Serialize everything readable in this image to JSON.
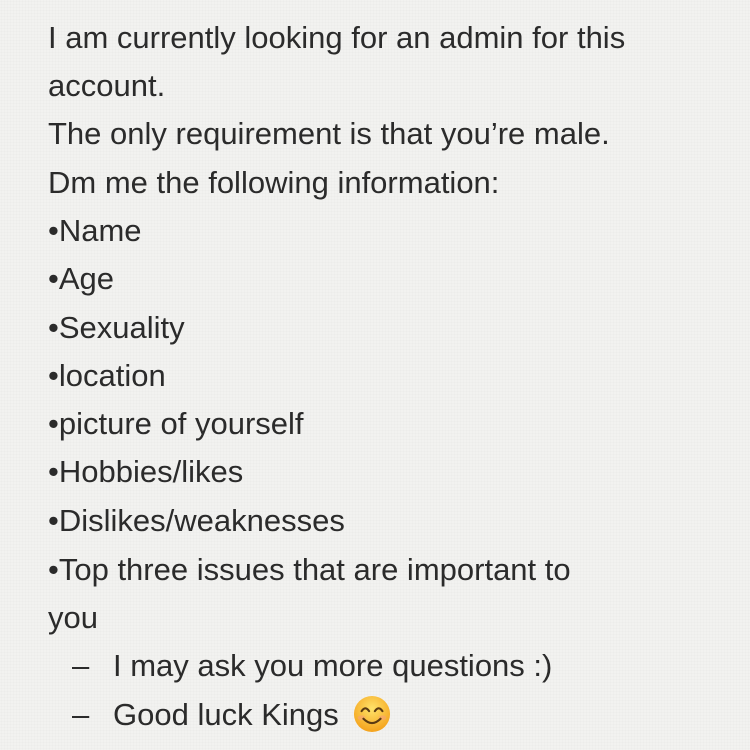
{
  "note": {
    "lines": [
      "I am currently looking for an admin for this",
      "account.",
      "The only requirement is that you’re male.",
      "Dm me the following information:",
      "•Name",
      "•Age",
      "•Sexuality",
      "•location",
      "•picture of yourself",
      "•Hobbies/likes",
      "•Dislikes/weaknesses",
      "•Top three issues that are important to",
      "you"
    ],
    "sub_items": [
      {
        "marker": "–",
        "text": "I may ask you more questions :)"
      },
      {
        "marker": "–",
        "text": "Good luck Kings",
        "icon": "smiling-face-emoji"
      }
    ]
  }
}
